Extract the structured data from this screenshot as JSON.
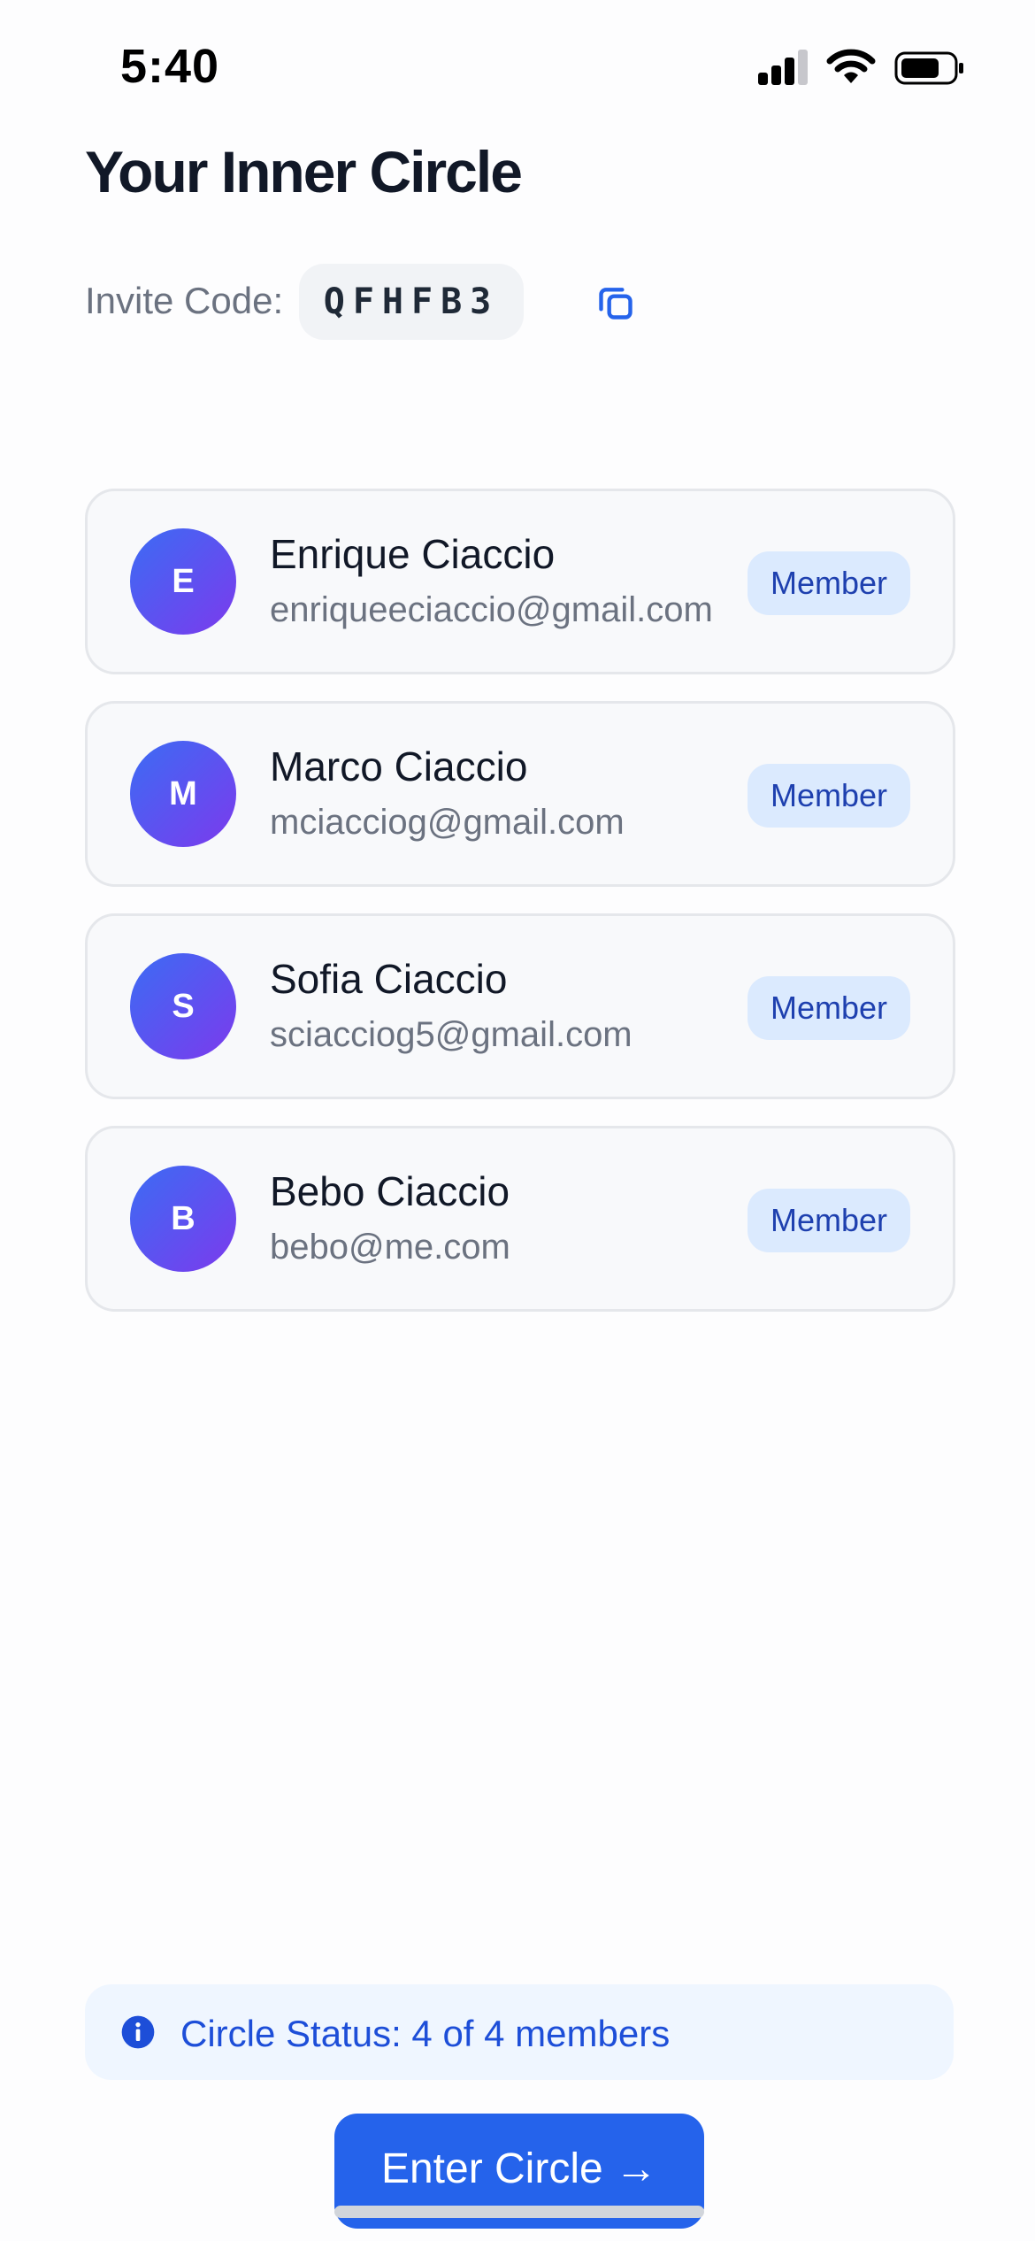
{
  "status_bar": {
    "time": "5:40"
  },
  "page": {
    "title": "Your Inner Circle"
  },
  "invite": {
    "label": "Invite Code:",
    "code": "QFHFB3"
  },
  "members": [
    {
      "initial": "E",
      "name": "Enrique Ciaccio",
      "email": "enriqueeciaccio@gmail.com",
      "role": "Member"
    },
    {
      "initial": "M",
      "name": "Marco Ciaccio",
      "email": "mciacciog@gmail.com",
      "role": "Member"
    },
    {
      "initial": "S",
      "name": "Sofia Ciaccio",
      "email": "sciacciog5@gmail.com",
      "role": "Member"
    },
    {
      "initial": "B",
      "name": "Bebo Ciaccio",
      "email": "bebo@me.com",
      "role": "Member"
    }
  ],
  "circle_status": {
    "text": "Circle Status: 4 of 4 members"
  },
  "actions": {
    "enter_label": "Enter Circle →"
  },
  "colors": {
    "accent": "#2563eb",
    "badge_bg": "#dbeafe",
    "badge_text": "#1e40af",
    "avatar_from": "#3b6cf4",
    "avatar_to": "#7c3aed"
  }
}
